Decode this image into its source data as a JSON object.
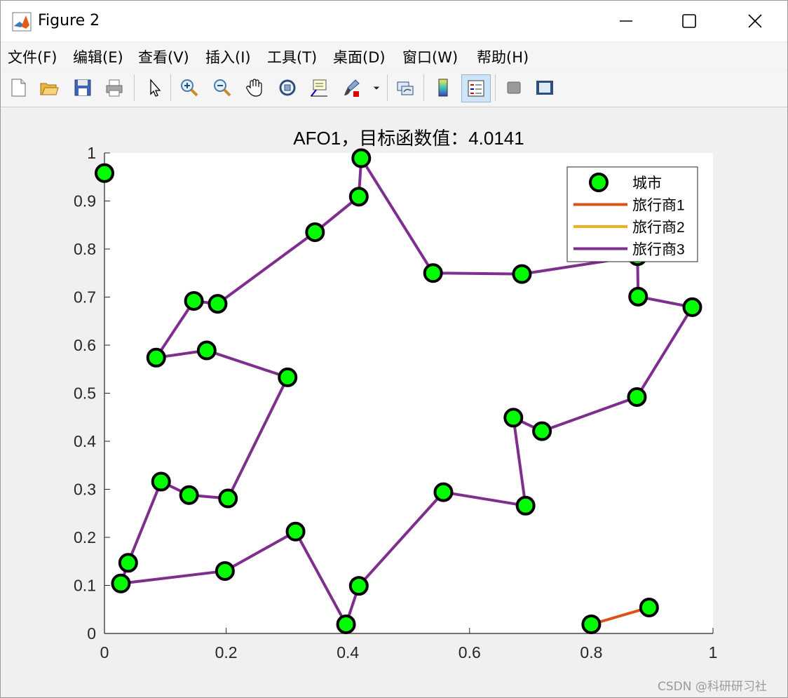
{
  "window": {
    "title": "Figure 2"
  },
  "menu": [
    {
      "key": "file",
      "label": "文件(F)"
    },
    {
      "key": "edit",
      "label": "编辑(E)"
    },
    {
      "key": "view",
      "label": "查看(V)"
    },
    {
      "key": "insert",
      "label": "插入(I)"
    },
    {
      "key": "tools",
      "label": "工具(T)"
    },
    {
      "key": "desktop",
      "label": "桌面(D)"
    },
    {
      "key": "window",
      "label": "窗口(W)"
    },
    {
      "key": "help",
      "label": "帮助(H)"
    }
  ],
  "toolbar": {
    "icons": [
      "new-figure-icon",
      "open-file-icon",
      "save-icon",
      "print-icon",
      "pointer-icon",
      "zoom-in-icon",
      "zoom-out-icon",
      "pan-hand-icon",
      "rotate-3d-icon",
      "data-cursor-icon",
      "brush-icon",
      "brush-dropdown-icon",
      "link-plot-icon",
      "colorbar-icon",
      "legend-icon",
      "hide-plot-tools-icon",
      "show-plot-tools-icon"
    ],
    "active": "legend-icon"
  },
  "colors": {
    "city_fill": "#00ff00",
    "salesman1": "#d95319",
    "salesman2": "#edb120",
    "salesman3": "#7e2f8e"
  },
  "chart_data": {
    "type": "line",
    "title": "AFO1，目标函数值：4.0141",
    "xlim": [
      0,
      1
    ],
    "ylim": [
      0,
      1
    ],
    "xticks": [
      "0",
      "0.2",
      "0.4",
      "0.6",
      "0.8",
      "1"
    ],
    "yticks": [
      "0",
      "0.1",
      "0.2",
      "0.3",
      "0.4",
      "0.5",
      "0.6",
      "0.7",
      "0.8",
      "0.9",
      "1"
    ],
    "legend": [
      "城市",
      "旅行商1",
      "旅行商2",
      "旅行商3"
    ],
    "legend_position": "top-right",
    "cities": [
      [
        0.0,
        0.958
      ],
      [
        0.422,
        0.989
      ],
      [
        0.418,
        0.909
      ],
      [
        0.346,
        0.835
      ],
      [
        0.186,
        0.686
      ],
      [
        0.147,
        0.692
      ],
      [
        0.085,
        0.574
      ],
      [
        0.168,
        0.589
      ],
      [
        0.301,
        0.533
      ],
      [
        0.203,
        0.281
      ],
      [
        0.139,
        0.288
      ],
      [
        0.093,
        0.316
      ],
      [
        0.039,
        0.147
      ],
      [
        0.027,
        0.104
      ],
      [
        0.198,
        0.13
      ],
      [
        0.314,
        0.212
      ],
      [
        0.397,
        0.019
      ],
      [
        0.418,
        0.099
      ],
      [
        0.557,
        0.294
      ],
      [
        0.692,
        0.266
      ],
      [
        0.672,
        0.449
      ],
      [
        0.719,
        0.421
      ],
      [
        0.875,
        0.492
      ],
      [
        0.966,
        0.679
      ],
      [
        0.877,
        0.701
      ],
      [
        0.876,
        0.785
      ],
      [
        0.686,
        0.748
      ],
      [
        0.54,
        0.75
      ],
      [
        0.8,
        0.019
      ],
      [
        0.895,
        0.054
      ]
    ],
    "series": [
      {
        "name": "旅行商1",
        "x": [
          0.8,
          0.895
        ],
        "y": [
          0.019,
          0.054
        ]
      },
      {
        "name": "旅行商2",
        "x": [],
        "y": []
      },
      {
        "name": "旅行商3",
        "x": [
          0.418,
          0.422,
          0.54,
          0.686,
          0.876,
          0.877,
          0.966,
          0.875,
          0.719,
          0.672,
          0.692,
          0.557,
          0.418,
          0.397,
          0.314,
          0.198,
          0.027,
          0.039,
          0.093,
          0.139,
          0.203,
          0.301,
          0.168,
          0.085,
          0.147,
          0.186,
          0.346,
          0.418
        ],
        "y": [
          0.909,
          0.989,
          0.75,
          0.748,
          0.785,
          0.701,
          0.679,
          0.492,
          0.421,
          0.449,
          0.266,
          0.294,
          0.099,
          0.019,
          0.212,
          0.13,
          0.104,
          0.147,
          0.316,
          0.288,
          0.281,
          0.533,
          0.589,
          0.574,
          0.692,
          0.686,
          0.835,
          0.909
        ]
      }
    ]
  },
  "watermark": "CSDN @科研研习社"
}
